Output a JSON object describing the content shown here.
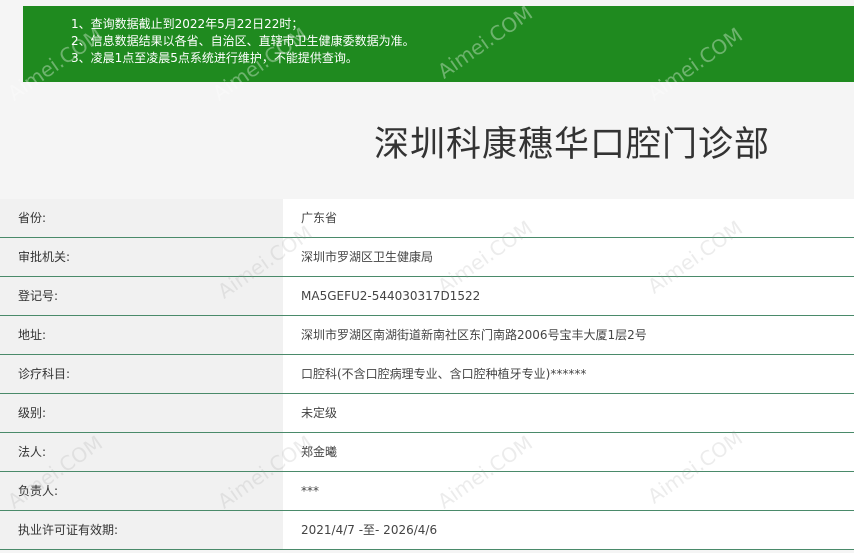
{
  "notice": {
    "lines": [
      "1、查询数据截止到2022年5月22日22时；",
      "2、信息数据结果以各省、自治区、直辖市卫生健康委数据为准。",
      "3、凌晨1点至凌晨5点系统进行维护，不能提供查询。"
    ]
  },
  "page_title": "深圳科康穗华口腔门诊部",
  "rows": [
    {
      "label": "省份:",
      "value": "广东省"
    },
    {
      "label": "审批机关:",
      "value": "深圳市罗湖区卫生健康局"
    },
    {
      "label": "登记号:",
      "value": "MA5GEFU2-544030317D1522"
    },
    {
      "label": "地址:",
      "value": "深圳市罗湖区南湖街道新南社区东门南路2006号宝丰大厦1层2号"
    },
    {
      "label": "诊疗科目:",
      "value": "口腔科(不含口腔病理专业、含口腔种植牙专业)******"
    },
    {
      "label": "级别:",
      "value": "未定级"
    },
    {
      "label": "法人:",
      "value": "郑金曦"
    },
    {
      "label": "负责人:",
      "value": "***"
    },
    {
      "label": "执业许可证有效期:",
      "value": "2021/4/7 -至- 2026/4/6"
    }
  ],
  "watermark": {
    "text": "Aimei.COM"
  },
  "colors": {
    "notice_bg": "#1f8a1f",
    "row_border": "#4a8a6a"
  }
}
